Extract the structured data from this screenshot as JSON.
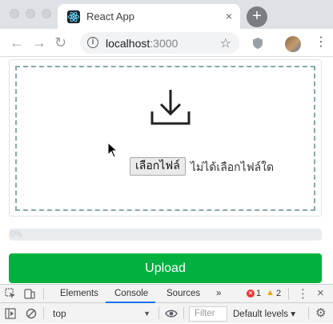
{
  "browser": {
    "tab": {
      "title": "React App",
      "close": "×"
    },
    "new_tab": "+",
    "nav": {
      "back": "←",
      "forward": "→",
      "reload": "↻"
    },
    "address": {
      "host": "localhost",
      "port": ":3000",
      "info": "i"
    },
    "bookmark_star": "☆",
    "menu_dots": "⋮"
  },
  "page": {
    "file_input": {
      "button_label": "เลือกไฟล์",
      "status": "ไม่ได้เลือกไฟล์ใด"
    },
    "progress": {
      "label": "0%",
      "value": 0
    },
    "upload_button": "Upload"
  },
  "devtools": {
    "tabs": [
      "Elements",
      "Console",
      "Sources"
    ],
    "active_tab": "Console",
    "more": "»",
    "errors": "1",
    "warnings": "2",
    "warn_glyph": "▲",
    "err_glyph": "×",
    "close": "×",
    "kebab": "⋮",
    "context": "top",
    "context_arrow": "▼",
    "filter_placeholder": "Filter",
    "levels": "Default levels ▾",
    "gear": "⚙"
  },
  "colors": {
    "upload_button": "#00b140",
    "dropzone_border": "#8aa8ad",
    "active_tab_underline": "#1a73e8"
  }
}
